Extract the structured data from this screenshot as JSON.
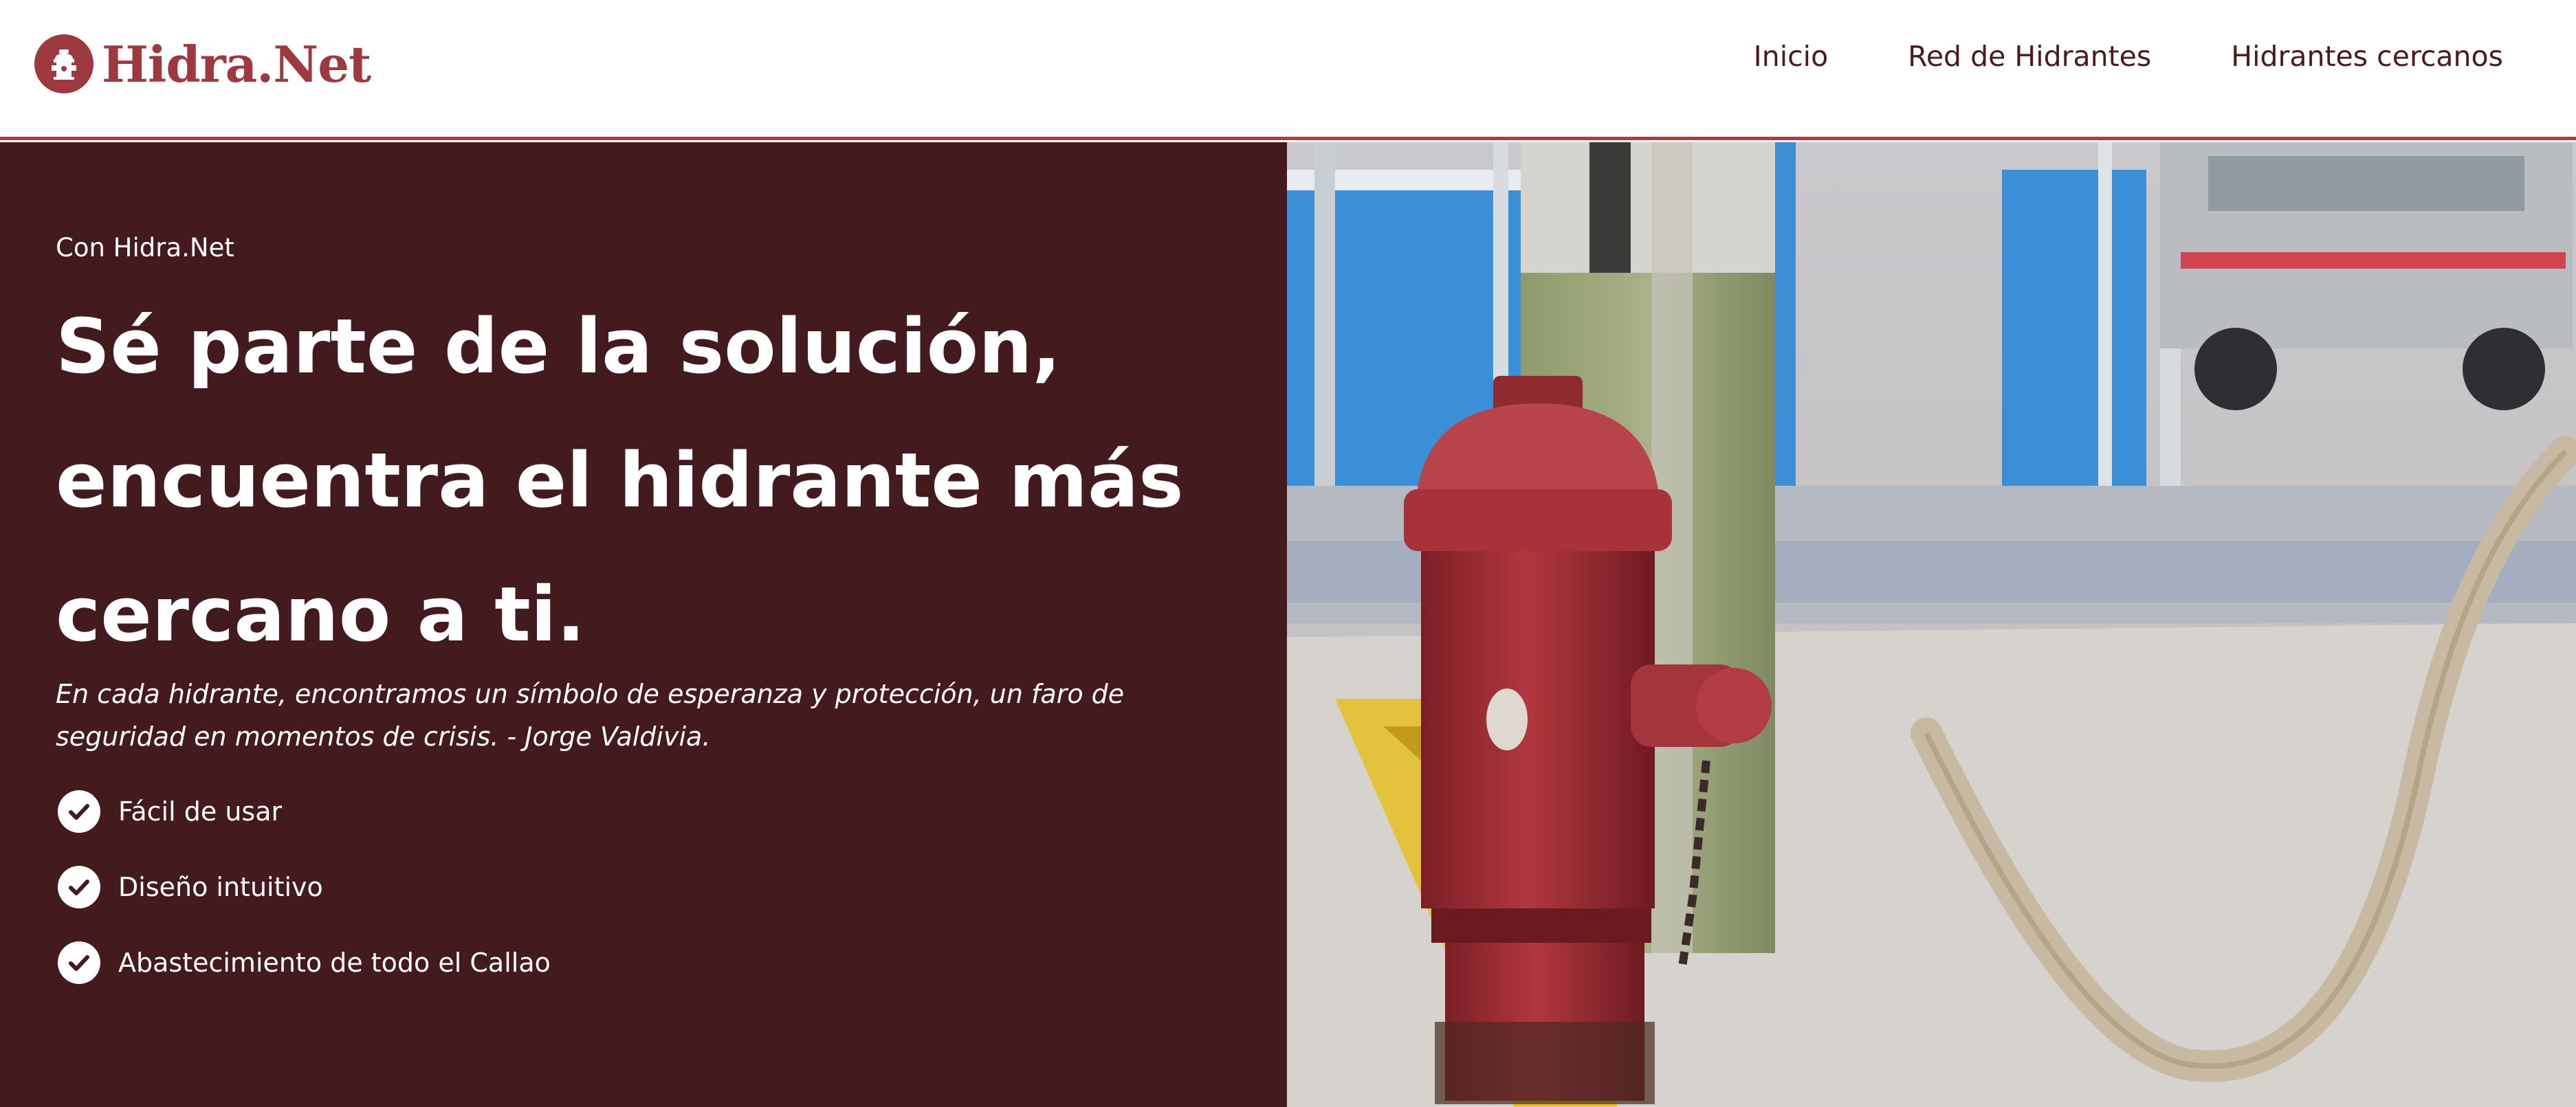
{
  "brand": {
    "name": "Hidra.Net",
    "logo_icon": "fire-hydrant-icon",
    "color": "#9e3a3f"
  },
  "nav": {
    "items": [
      {
        "label": "Inicio"
      },
      {
        "label": "Red de Hidrantes"
      },
      {
        "label": "Hidrantes cercanos"
      }
    ]
  },
  "hero": {
    "eyebrow": "Con Hidra.Net",
    "headline_lines": [
      "Sé parte de la solución,",
      "encuentra el hidrante más",
      "cercano a ti."
    ],
    "quote": "En cada hidrante, encontramos un símbolo de esperanza y protección, un faro de seguridad en momentos de crisis. - Jorge Valdivia.",
    "features": [
      {
        "icon": "check-circle-icon",
        "label": "Fácil de usar"
      },
      {
        "icon": "check-circle-icon",
        "label": "Diseño intuitivo"
      },
      {
        "icon": "check-circle-icon",
        "label": "Abastecimiento de todo el Callao"
      }
    ],
    "background_color": "#431b1e",
    "image": "fire-hydrant-photo"
  },
  "colors": {
    "accent": "#b23a43",
    "nav_text": "#4a1a1d"
  }
}
